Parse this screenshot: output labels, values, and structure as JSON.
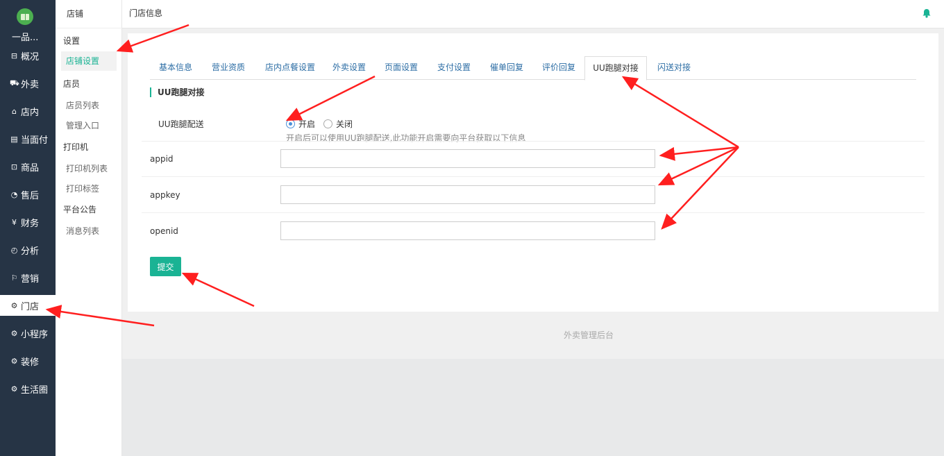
{
  "brand": {
    "name": "一品..."
  },
  "nav": {
    "items": [
      {
        "icon": "dashboard-icon",
        "glyph": "⊟",
        "label": "概况"
      },
      {
        "icon": "delivery-icon",
        "glyph": "⛟",
        "label": "外卖"
      },
      {
        "icon": "store-icon",
        "glyph": "⌂",
        "label": "店内"
      },
      {
        "icon": "face-pay-icon",
        "glyph": "▤",
        "label": "当面付"
      },
      {
        "icon": "goods-icon",
        "glyph": "⊡",
        "label": "商品"
      },
      {
        "icon": "after-sales-icon",
        "glyph": "◔",
        "label": "售后"
      },
      {
        "icon": "finance-icon",
        "glyph": "¥",
        "label": "财务"
      },
      {
        "icon": "analysis-icon",
        "glyph": "◴",
        "label": "分析"
      },
      {
        "icon": "marketing-icon",
        "glyph": "⚐",
        "label": "营销"
      },
      {
        "icon": "shop-gear-icon",
        "glyph": "⚙",
        "label": "门店"
      },
      {
        "icon": "miniapp-gear-icon",
        "glyph": "⚙",
        "label": "小程序"
      },
      {
        "icon": "decor-gear-icon",
        "glyph": "⚙",
        "label": "装修"
      },
      {
        "icon": "life-gear-icon",
        "glyph": "⚙",
        "label": "生活圈"
      }
    ]
  },
  "subnav": {
    "title": "店铺",
    "group_settings": "设置",
    "item_shop_settings": "店铺设置",
    "group_staff": "店员",
    "item_staff_list": "店员列表",
    "item_admin_entry": "管理入口",
    "group_printer": "打印机",
    "item_printer_list": "打印机列表",
    "item_print_label": "打印标签",
    "group_notice": "平台公告",
    "item_message_list": "消息列表"
  },
  "header": {
    "title": "门店信息",
    "bell_icon": "bell-icon"
  },
  "tabs": [
    "基本信息",
    "营业资质",
    "店内点餐设置",
    "外卖设置",
    "页面设置",
    "支付设置",
    "催单回复",
    "评价回复",
    "UU跑腿对接",
    "闪送对接"
  ],
  "form": {
    "section_title": "UU跑腿对接",
    "delivery_label": "UU跑腿配送",
    "radio_on": "开启",
    "radio_off": "关闭",
    "radio_selected": "开启",
    "hint": "开启后可以使用UU跑腿配送,此功能开启需要向平台获取以下信息",
    "appid_label": "appid",
    "appid_value": "",
    "appkey_label": "appkey",
    "appkey_value": "",
    "openid_label": "openid",
    "openid_value": "",
    "submit_label": "提交"
  },
  "footer": {
    "text": "外卖管理后台"
  },
  "colors": {
    "accent": "#1ab394",
    "sidebar": "#263445",
    "link": "#2d6ea5",
    "annotation": "#ff1f1f"
  }
}
